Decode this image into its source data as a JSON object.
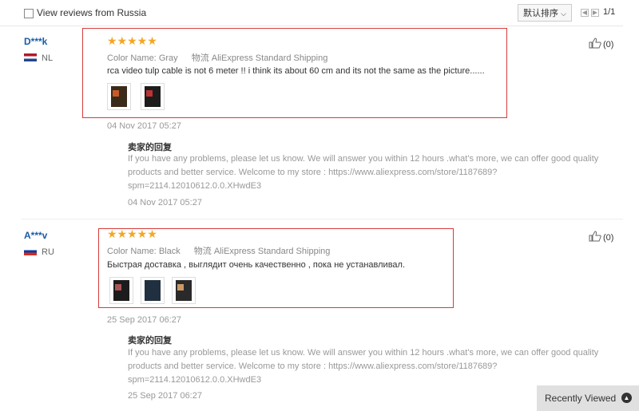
{
  "filter": {
    "label": "View reviews from Russia",
    "checked": false
  },
  "sort": {
    "label": "默认排序"
  },
  "pager": {
    "text": "1/1"
  },
  "reviews": [
    {
      "user": "D***k",
      "country": "NL",
      "stars": "★★★★★",
      "color_label": "Color Name:",
      "color_value": "Gray",
      "shipping_label": "物流",
      "shipping_value": "AliExpress Standard Shipping",
      "text": "rca video tulp cable is not 6 meter !! i think its about 60 cm and its not the same as the picture......",
      "date": "04 Nov 2017 05:27",
      "likes": "(0)",
      "reply": {
        "title": "卖家的回复",
        "text": "If you have any problems, please let us know. We will answer you within 12 hours .what's more, we can offer good quality products and better service. Welcome to my store : https://www.aliexpress.com/store/1187689?spm=2114.12010612.0.0.XHwdE3",
        "date": "04 Nov 2017 05:27"
      }
    },
    {
      "user": "A***v",
      "country": "RU",
      "stars": "★★★★★",
      "color_label": "Color Name:",
      "color_value": "Black",
      "shipping_label": "物流",
      "shipping_value": "AliExpress Standard Shipping",
      "text": "Быстрая доставка , выглядит очень качественно , пока не устанавливал.",
      "date": "25 Sep 2017 06:27",
      "likes": "(0)",
      "reply": {
        "title": "卖家的回复",
        "text": "If you have any problems, please let us know. We will answer you within 12 hours .what's more, we can offer good quality products and better service. Welcome to my store : https://www.aliexpress.com/store/1187689?spm=2114.12010612.0.0.XHwdE3",
        "date": "25 Sep 2017 06:27"
      }
    }
  ],
  "recently_viewed": {
    "label": "Recently Viewed"
  },
  "colors": {
    "link": "#1a5ca6",
    "star": "#f5a623",
    "highlight": "#d63b3b"
  }
}
